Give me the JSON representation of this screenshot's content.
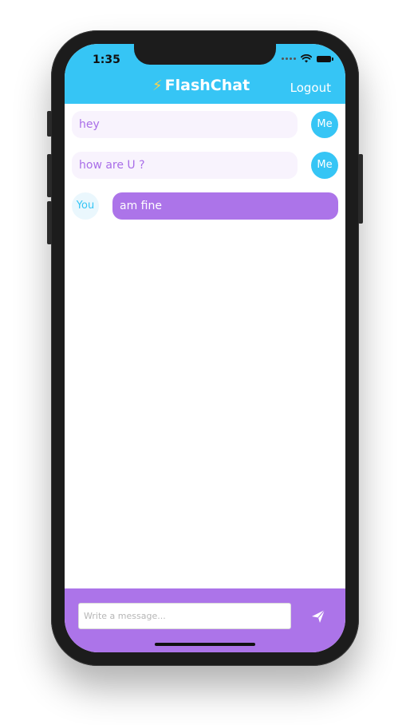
{
  "status_bar": {
    "time": "1:35"
  },
  "header": {
    "bolt_icon": "lightning-bolt-icon",
    "bolt_glyph": "⚡",
    "title": "FlashChat",
    "logout_label": "Logout"
  },
  "messages": [
    {
      "text": "hey",
      "sender_label": "Me",
      "mine": true
    },
    {
      "text": "how are U ?",
      "sender_label": "Me",
      "mine": true
    },
    {
      "text": "am fine",
      "sender_label": "You",
      "mine": false
    }
  ],
  "composer": {
    "placeholder": "Write a message...",
    "value": "",
    "send_icon": "paper-plane-icon"
  },
  "colors": {
    "header": "#36c5f5",
    "accent": "#ac74e9",
    "my_bubble": "#f8f3fd",
    "my_text": "#a96ee8"
  }
}
